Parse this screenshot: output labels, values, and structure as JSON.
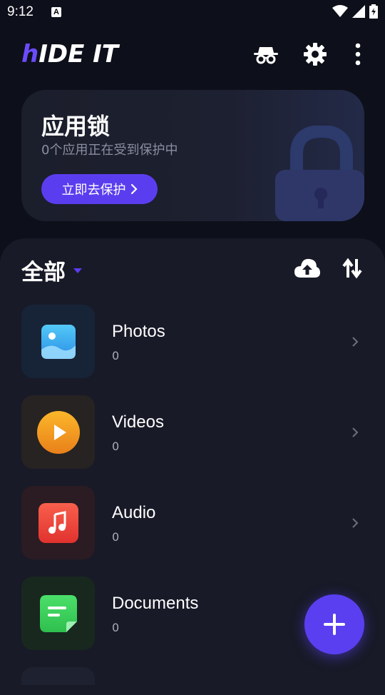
{
  "status_bar": {
    "time": "9:12",
    "a_badge": "A"
  },
  "header": {
    "logo_first": "h",
    "logo_rest": "IDE IT",
    "accent": "#6b4bff"
  },
  "lock_card": {
    "title": "应用锁",
    "subtitle": "0个应用正在受到保护中",
    "button_label": "立即去保护",
    "button_color": "#5b3df0"
  },
  "files": {
    "filter_label": "全部",
    "categories": [
      {
        "name": "Photos",
        "count": "0",
        "icon": "image-icon",
        "tile_color": "#172337",
        "icon_color": "#3fa9ee"
      },
      {
        "name": "Videos",
        "count": "0",
        "icon": "play-icon",
        "tile_color": "#262322",
        "icon_color": "#f29a1d"
      },
      {
        "name": "Audio",
        "count": "0",
        "icon": "music-note-icon",
        "tile_color": "#2a1c22",
        "icon_color": "#ef4b3e"
      },
      {
        "name": "Documents",
        "count": "0",
        "icon": "document-icon",
        "tile_color": "#18281f",
        "icon_color": "#3ed25e"
      }
    ]
  },
  "fab": {
    "icon": "plus-icon",
    "color": "#5a3ff0"
  }
}
